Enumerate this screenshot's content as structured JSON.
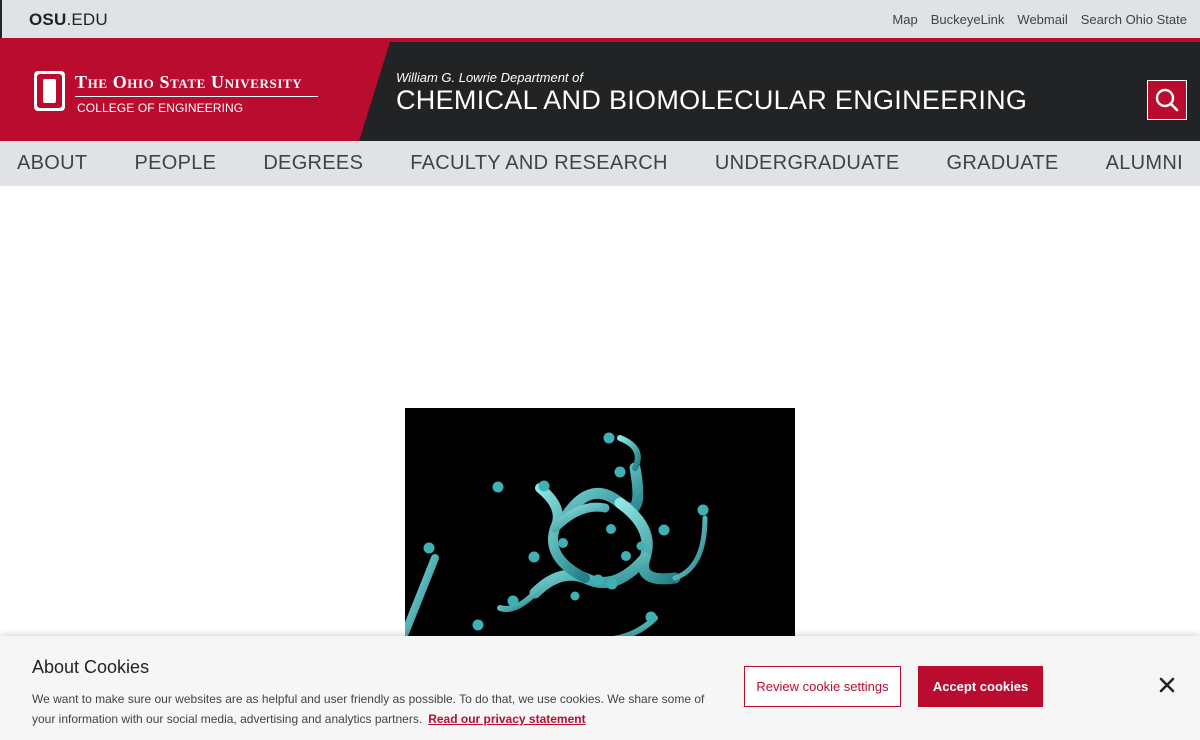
{
  "topbar": {
    "osu_bold": "OSU",
    "osu_rest": ".EDU",
    "links": [
      "Map",
      "BuckeyeLink",
      "Webmail",
      "Search Ohio State"
    ]
  },
  "header": {
    "university": "The Ohio State University",
    "college": "COLLEGE OF ENGINEERING",
    "dept_prefix": "William G. Lowrie Department of",
    "dept_name": "CHEMICAL AND BIOMOLECULAR ENGINEERING",
    "search_icon": "search-icon"
  },
  "nav": {
    "items": [
      "ABOUT",
      "PEOPLE",
      "DEGREES",
      "FACULTY AND RESEARCH",
      "UNDERGRADUATE",
      "GRADUATE",
      "ALUMNI"
    ]
  },
  "cookie": {
    "title": "About Cookies",
    "text": "We want to make sure our websites are as helpful and user friendly as possible. To do that, we use cookies. We share some of your information with our social media, advertising and analytics partners.",
    "privacy_link": "Read our privacy statement",
    "review_label": "Review cookie settings",
    "accept_label": "Accept cookies",
    "close_icon": "close-icon"
  },
  "colors": {
    "scarlet": "#ba0c2f",
    "dark": "#212325",
    "gray_bar": "#e0e2e5",
    "molecule": "#3fb0b4"
  }
}
